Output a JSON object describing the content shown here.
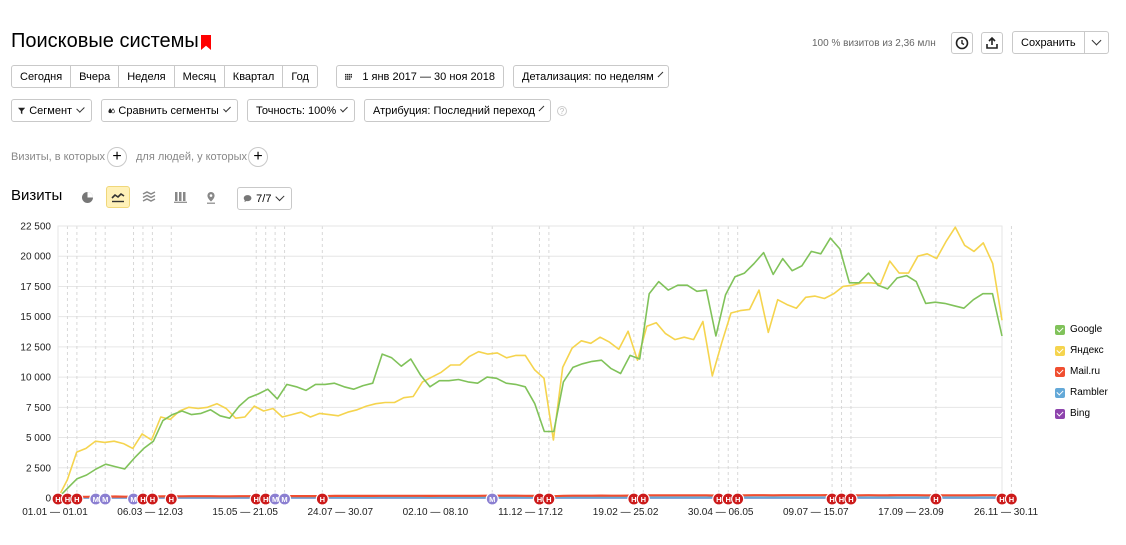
{
  "header": {
    "title": "Поисковые системы",
    "visits_info": "100 % визитов из 2,36 млн",
    "save_label": "Сохранить"
  },
  "period_buttons": [
    "Сегодня",
    "Вчера",
    "Неделя",
    "Месяц",
    "Квартал",
    "Год"
  ],
  "date_range": "1 янв 2017 — 30 ноя 2018",
  "detail": "Детализация: по неделям",
  "filters": {
    "segment": "Сегмент",
    "compare": "Сравнить сегменты",
    "accuracy": "Точность: 100%",
    "attribution": "Атрибуция: Последний переход",
    "help": "?"
  },
  "conditions": {
    "visits_where": "Визиты, в которых",
    "people_where": "для людей, у которых"
  },
  "chart_section": {
    "title": "Визиты",
    "annotations_count": "7/7"
  },
  "chart_data": {
    "type": "line",
    "yticks": [
      "22 500",
      "20 000",
      "17 500",
      "15 000",
      "12 500",
      "10 000",
      "7 500",
      "5 000",
      "2 500",
      "0"
    ],
    "ylim": [
      0,
      22500
    ],
    "xticks": [
      "01.01 — 01.01",
      "06.03 — 12.03",
      "15.05 — 21.05",
      "24.07 — 30.07",
      "02.10 — 08.10",
      "11.12 — 17.12",
      "19.02 — 25.02",
      "30.04 — 06.05",
      "09.07 — 15.07",
      "17.09 — 23.09",
      "26.11 — 30.11"
    ],
    "grid": true,
    "legend_position": "right",
    "series": [
      {
        "name": "Google",
        "color": "#80c25a",
        "values": [
          0,
          800,
          1600,
          1900,
          2400,
          2800,
          2600,
          2400,
          3300,
          4100,
          4700,
          6400,
          6900,
          7200,
          6900,
          7000,
          7300,
          6800,
          6600,
          7600,
          8300,
          8600,
          9000,
          8200,
          9400,
          9200,
          8900,
          9400,
          9400,
          9500,
          9200,
          9000,
          9300,
          9500,
          11900,
          11600,
          10900,
          11500,
          10200,
          9200,
          9700,
          9700,
          9800,
          9600,
          9500,
          10000,
          9900,
          9500,
          9400,
          9200,
          7800,
          5500,
          5500,
          9600,
          10800,
          11100,
          11300,
          11400,
          10700,
          10300,
          11800,
          11500,
          16900,
          17900,
          17200,
          17600,
          17600,
          17100,
          17200,
          13400,
          16800,
          18300,
          18600,
          19400,
          20300,
          18500,
          19800,
          18800,
          19200,
          20400,
          20200,
          21500,
          20600,
          17800,
          17800,
          18600,
          17600,
          17300,
          18200,
          18400,
          17900,
          16100,
          16200,
          16100,
          15900,
          15700,
          16400,
          16900,
          16900,
          13400
        ]
      },
      {
        "name": "Яндекс",
        "color": "#f5d44e",
        "values": [
          0,
          1500,
          3800,
          4100,
          4700,
          4600,
          4700,
          4500,
          4100,
          5300,
          4800,
          6700,
          6500,
          7200,
          7500,
          7400,
          7500,
          7800,
          7400,
          6600,
          6700,
          7600,
          7200,
          7400,
          6700,
          6900,
          7100,
          6700,
          7000,
          6900,
          6800,
          7100,
          7300,
          7600,
          7800,
          7900,
          7900,
          8300,
          8400,
          9600,
          10000,
          10400,
          11000,
          11000,
          11700,
          12100,
          11900,
          12000,
          11600,
          11800,
          11800,
          10600,
          9900,
          4800,
          10800,
          12400,
          13000,
          12800,
          13300,
          12900,
          12300,
          13800,
          11400,
          14200,
          14500,
          13600,
          13100,
          13300,
          13100,
          14600,
          10100,
          12800,
          15300,
          15500,
          15600,
          17200,
          13700,
          16400,
          16000,
          15700,
          16600,
          16700,
          16500,
          16900,
          17500,
          17600,
          17800,
          17800,
          17700,
          19600,
          18600,
          18600,
          20000,
          20200,
          19800,
          21200,
          22400,
          20900,
          20400,
          21100,
          19400,
          14700
        ]
      },
      {
        "name": "Mail.ru",
        "color": "#f04e30",
        "values": [
          0,
          80,
          100,
          100,
          110,
          110,
          120,
          110,
          110,
          120,
          120,
          130,
          140,
          140,
          150,
          150,
          150,
          140,
          140,
          150,
          150,
          160,
          160,
          150,
          160,
          160,
          160,
          160,
          160,
          170,
          170,
          170,
          170,
          170,
          180,
          180,
          180,
          180,
          180,
          170,
          180,
          180,
          180,
          180,
          180,
          190,
          190,
          190,
          190,
          180,
          170,
          150,
          150,
          180,
          190,
          190,
          190,
          200,
          190,
          190,
          200,
          200,
          220,
          220,
          220,
          220,
          220,
          220,
          220,
          200,
          210,
          220,
          220,
          230,
          230,
          220,
          230,
          230,
          230,
          230,
          230,
          240,
          240,
          220,
          220,
          230,
          220,
          220,
          230,
          230,
          230,
          220,
          220,
          220,
          220,
          220,
          220,
          230,
          230,
          200
        ]
      },
      {
        "name": "Rambler",
        "color": "#64a9d8",
        "values": [
          0,
          30,
          40,
          40,
          40,
          40,
          40,
          40,
          40,
          40,
          40,
          40,
          40,
          40,
          40,
          40,
          40,
          40,
          40,
          40,
          40,
          40,
          40,
          40,
          40,
          40,
          40,
          40,
          40,
          40,
          40,
          40,
          40,
          40,
          40,
          40,
          40,
          40,
          40,
          40,
          40,
          40,
          40,
          40,
          40,
          40,
          40,
          40,
          40,
          40,
          40,
          40,
          40,
          40,
          40,
          40,
          40,
          40,
          40,
          40,
          40,
          40,
          40,
          40,
          40,
          40,
          40,
          40,
          40,
          40,
          40,
          40,
          40,
          40,
          40,
          40,
          40,
          40,
          40,
          40,
          40,
          40,
          40,
          40,
          40,
          40,
          40,
          40,
          40,
          40,
          40,
          40,
          40,
          40,
          40,
          40,
          40,
          40,
          40,
          30
        ]
      },
      {
        "name": "Bing",
        "color": "#8e44ad",
        "values": [
          0,
          20,
          30,
          30,
          30,
          30,
          30,
          30,
          30,
          30,
          30,
          30,
          30,
          30,
          30,
          30,
          30,
          30,
          30,
          30,
          30,
          30,
          30,
          30,
          30,
          30,
          30,
          30,
          30,
          30,
          30,
          30,
          30,
          30,
          30,
          30,
          30,
          30,
          30,
          30,
          30,
          30,
          30,
          30,
          30,
          30,
          30,
          30,
          30,
          30,
          30,
          30,
          30,
          30,
          30,
          30,
          30,
          30,
          30,
          30,
          30,
          30,
          30,
          30,
          30,
          30,
          30,
          30,
          30,
          30,
          30,
          30,
          30,
          30,
          30,
          30,
          30,
          30,
          30,
          30,
          30,
          30,
          30,
          30,
          30,
          30,
          30,
          30,
          30,
          30,
          30,
          30,
          30,
          30,
          30,
          30,
          30,
          30,
          30,
          20
        ]
      }
    ],
    "annotation_markers": [
      {
        "label": "Н",
        "type": "red",
        "week": 0
      },
      {
        "label": "Н",
        "type": "red",
        "week": 1
      },
      {
        "label": "Н",
        "type": "red",
        "week": 2
      },
      {
        "label": "М",
        "type": "purple",
        "week": 4
      },
      {
        "label": "М",
        "type": "purple",
        "week": 5
      },
      {
        "label": "М",
        "type": "purple",
        "week": 8
      },
      {
        "label": "Н",
        "type": "red",
        "week": 9
      },
      {
        "label": "Н",
        "type": "red",
        "week": 10
      },
      {
        "label": "Н",
        "type": "red",
        "week": 12
      },
      {
        "label": "Н",
        "type": "red",
        "week": 21
      },
      {
        "label": "Н",
        "type": "red",
        "week": 22
      },
      {
        "label": "М",
        "type": "purple",
        "week": 23
      },
      {
        "label": "М",
        "type": "purple",
        "week": 24
      },
      {
        "label": "Н",
        "type": "red",
        "week": 28
      },
      {
        "label": "М",
        "type": "purple",
        "week": 46
      },
      {
        "label": "Н",
        "type": "red",
        "week": 51
      },
      {
        "label": "Н",
        "type": "red",
        "week": 52
      },
      {
        "label": "Н",
        "type": "red",
        "week": 61
      },
      {
        "label": "Н",
        "type": "red",
        "week": 62
      },
      {
        "label": "Н",
        "type": "red",
        "week": 70
      },
      {
        "label": "Н",
        "type": "red",
        "week": 71
      },
      {
        "label": "Н",
        "type": "red",
        "week": 72
      },
      {
        "label": "Н",
        "type": "red",
        "week": 82
      },
      {
        "label": "Н",
        "type": "red",
        "week": 83
      },
      {
        "label": "Н",
        "type": "red",
        "week": 84
      },
      {
        "label": "Н",
        "type": "red",
        "week": 93
      },
      {
        "label": "Н",
        "type": "red",
        "week": 100
      },
      {
        "label": "Н",
        "type": "red",
        "week": 101
      }
    ],
    "weeks_total": 100
  }
}
